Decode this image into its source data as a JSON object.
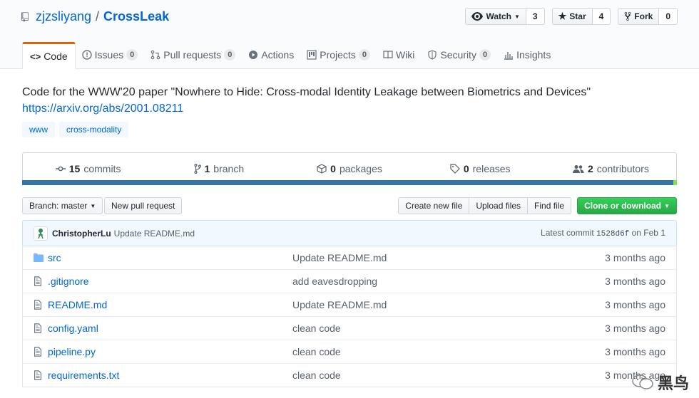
{
  "header": {
    "owner": "zjzsliyang",
    "separator": "/",
    "repo": "CrossLeak",
    "watch": {
      "label": "Watch",
      "count": "3"
    },
    "star": {
      "label": "Star",
      "count": "4"
    },
    "fork": {
      "label": "Fork",
      "count": "0"
    }
  },
  "tabs": [
    {
      "label": "Code"
    },
    {
      "label": "Issues",
      "badge": "0"
    },
    {
      "label": "Pull requests",
      "badge": "0"
    },
    {
      "label": "Actions"
    },
    {
      "label": "Projects",
      "badge": "0"
    },
    {
      "label": "Wiki"
    },
    {
      "label": "Security",
      "badge": "0"
    },
    {
      "label": "Insights"
    }
  ],
  "description": "Code for the WWW'20 paper \"Nowhere to Hide: Cross-modal Identity Leakage between Biometrics and Devices\"",
  "homepage": "https://arxiv.org/abs/2001.08211",
  "topics": [
    "www",
    "cross-modality"
  ],
  "summary": {
    "commits": {
      "num": "15",
      "label": "commits"
    },
    "branches": {
      "num": "1",
      "label": "branch"
    },
    "packages": {
      "num": "0",
      "label": "packages"
    },
    "releases": {
      "num": "0",
      "label": "releases"
    },
    "contributors": {
      "num": "2",
      "label": "contributors"
    }
  },
  "language_colors": {
    "primary": "#3572A5",
    "secondary": "#89e051"
  },
  "filenav": {
    "branch_label": "Branch: master",
    "new_pr": "New pull request",
    "create_file": "Create new file",
    "upload": "Upload files",
    "find": "Find file",
    "clone": "Clone or download"
  },
  "commit": {
    "author": "ChristopherLu",
    "message": "Update README.md",
    "latest_label": "Latest commit",
    "sha": "1528d6f",
    "date": "on Feb 1"
  },
  "files": [
    {
      "name": "src",
      "type": "dir",
      "message": "Update README.md",
      "age": "3 months ago"
    },
    {
      "name": ".gitignore",
      "type": "file",
      "message": "add eavesdropping",
      "age": "3 months ago"
    },
    {
      "name": "README.md",
      "type": "file",
      "message": "Update README.md",
      "age": "3 months ago"
    },
    {
      "name": "config.yaml",
      "type": "file",
      "message": "clean code",
      "age": "3 months ago"
    },
    {
      "name": "pipeline.py",
      "type": "file",
      "message": "clean code",
      "age": "3 months ago"
    },
    {
      "name": "requirements.txt",
      "type": "file",
      "message": "clean code",
      "age": "3 months ago"
    }
  ],
  "watermark": "黑鸟"
}
